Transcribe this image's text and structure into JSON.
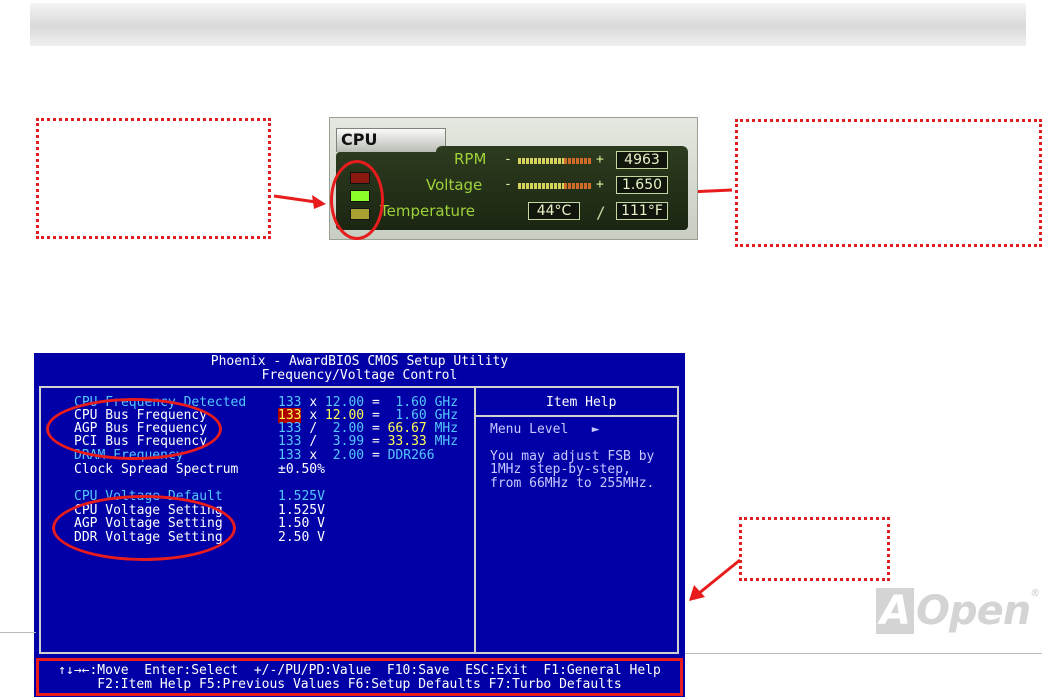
{
  "cpu_monitor": {
    "title": "CPU",
    "rpm": {
      "label": "RPM",
      "minus": "-",
      "plus": "+",
      "value": "4963"
    },
    "voltage": {
      "label": "Voltage",
      "minus": "-",
      "plus": "+",
      "value": "1.650"
    },
    "temperature": {
      "label": "Temperature",
      "celsius": "44",
      "celsius_unit": "°C",
      "separator": "/",
      "fahrenheit": "111",
      "fahrenheit_unit": "°F"
    },
    "leds": [
      "#8a1a10",
      "#8cff2a",
      "#a8a030"
    ]
  },
  "bios": {
    "title_line1": "Phoenix - AwardBIOS CMOS Setup Utility",
    "title_line2": "Frequency/Voltage Control",
    "rows": [
      {
        "label": "CPU Frequency Detected",
        "a": "133",
        "op": "x",
        "b": "12.00",
        "eq": "=",
        "c": "1.60",
        "unit": "GHz"
      },
      {
        "label": "CPU Bus Frequency",
        "a": "133",
        "op": "x",
        "b": "12.00",
        "eq": "=",
        "c": "1.60",
        "unit": "GHz"
      },
      {
        "label": "AGP Bus Frequency",
        "a": "133",
        "op": "/",
        "b": "2.00",
        "eq": "=",
        "c": "66.67",
        "unit": "MHz"
      },
      {
        "label": "PCI Bus Frequency",
        "a": "133",
        "op": "/",
        "b": "3.99",
        "eq": "=",
        "c": "33.33",
        "unit": "MHz"
      },
      {
        "label": "DRAM Frequency",
        "a": "133",
        "op": "x",
        "b": "2.00",
        "eq": "=",
        "c": "DDR266",
        "unit": ""
      },
      {
        "label": "Clock Spread Spectrum",
        "value": "±0.50%"
      },
      {
        "label": "CPU Voltage Default",
        "value": "1.525V"
      },
      {
        "label": "CPU Voltage Setting",
        "value": "1.525V"
      },
      {
        "label": "AGP Voltage Setting",
        "value": "1.50 V"
      },
      {
        "label": "DDR Voltage Setting",
        "value": "2.50 V"
      }
    ],
    "help": {
      "title": "Item Help",
      "menu_level": "Menu Level   ►",
      "text_lines": [
        "You may adjust FSB by",
        "1MHz step-by-step,",
        "from 66MHz to 255MHz."
      ]
    },
    "footer_line1": "↑↓→←:Move  Enter:Select  +/-/PU/PD:Value  F10:Save  ESC:Exit  F1:General Help",
    "footer_line2": "F2:Item Help F5:Previous Values F6:Setup Defaults F7:Turbo Defaults"
  },
  "logo": {
    "mark": "A",
    "text": "Open",
    "reg": "®"
  },
  "colors": {
    "accent_red": "#e81c1c",
    "bios_blue": "#0000a6",
    "bios_cyan": "#55c8ff",
    "bios_yellow": "#ffff55"
  }
}
